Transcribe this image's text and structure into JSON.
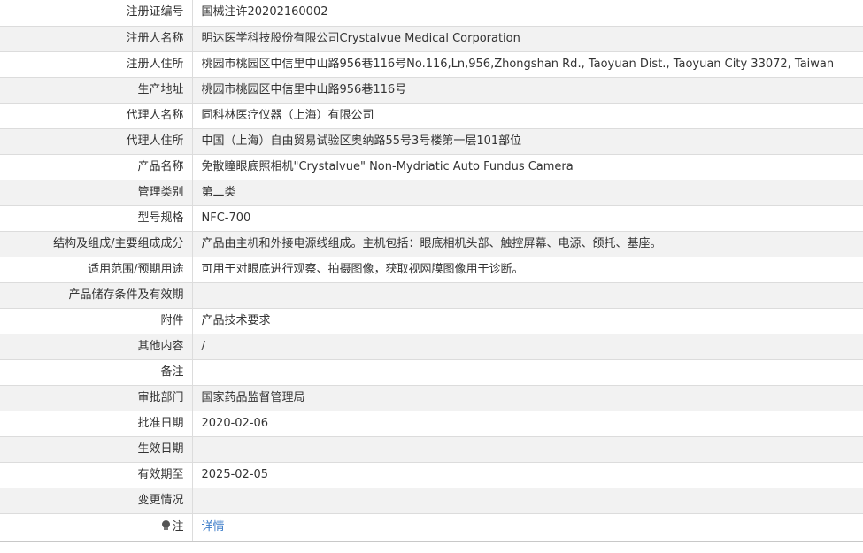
{
  "rows": [
    {
      "label": "注册证编号",
      "value": "国械注许20202160002"
    },
    {
      "label": "注册人名称",
      "value": "明达医学科技股份有限公司Crystalvue Medical Corporation"
    },
    {
      "label": "注册人住所",
      "value": "桃园市桃园区中信里中山路956巷116号No.116,Ln,956,Zhongshan Rd., Taoyuan Dist., Taoyuan City 33072, Taiwan"
    },
    {
      "label": "生产地址",
      "value": "桃园市桃园区中信里中山路956巷116号"
    },
    {
      "label": "代理人名称",
      "value": "同科林医疗仪器（上海）有限公司"
    },
    {
      "label": "代理人住所",
      "value": "中国（上海）自由贸易试验区奥纳路55号3号楼第一层101部位"
    },
    {
      "label": "产品名称",
      "value": "免散瞳眼底照相机\"Crystalvue\" Non-Mydriatic Auto Fundus Camera"
    },
    {
      "label": "管理类别",
      "value": "第二类"
    },
    {
      "label": "型号规格",
      "value": "NFC-700"
    },
    {
      "label": "结构及组成/主要组成成分",
      "value": "产品由主机和外接电源线组成。主机包括：眼底相机头部、触控屏幕、电源、颌托、基座。"
    },
    {
      "label": "适用范围/预期用途",
      "value": "可用于对眼底进行观察、拍摄图像，获取视网膜图像用于诊断。"
    },
    {
      "label": "产品储存条件及有效期",
      "value": ""
    },
    {
      "label": "附件",
      "value": "产品技术要求"
    },
    {
      "label": "其他内容",
      "value": "/"
    },
    {
      "label": "备注",
      "value": ""
    },
    {
      "label": "审批部门",
      "value": "国家药品监督管理局"
    },
    {
      "label": "批准日期",
      "value": "2020-02-06"
    },
    {
      "label": "生效日期",
      "value": ""
    },
    {
      "label": "有效期至",
      "value": "2025-02-05"
    },
    {
      "label": "变更情况",
      "value": ""
    }
  ],
  "note": {
    "icon": "lightbulb-icon",
    "label": "注",
    "link_text": "详情",
    "link_color": "#3a7bc8"
  }
}
